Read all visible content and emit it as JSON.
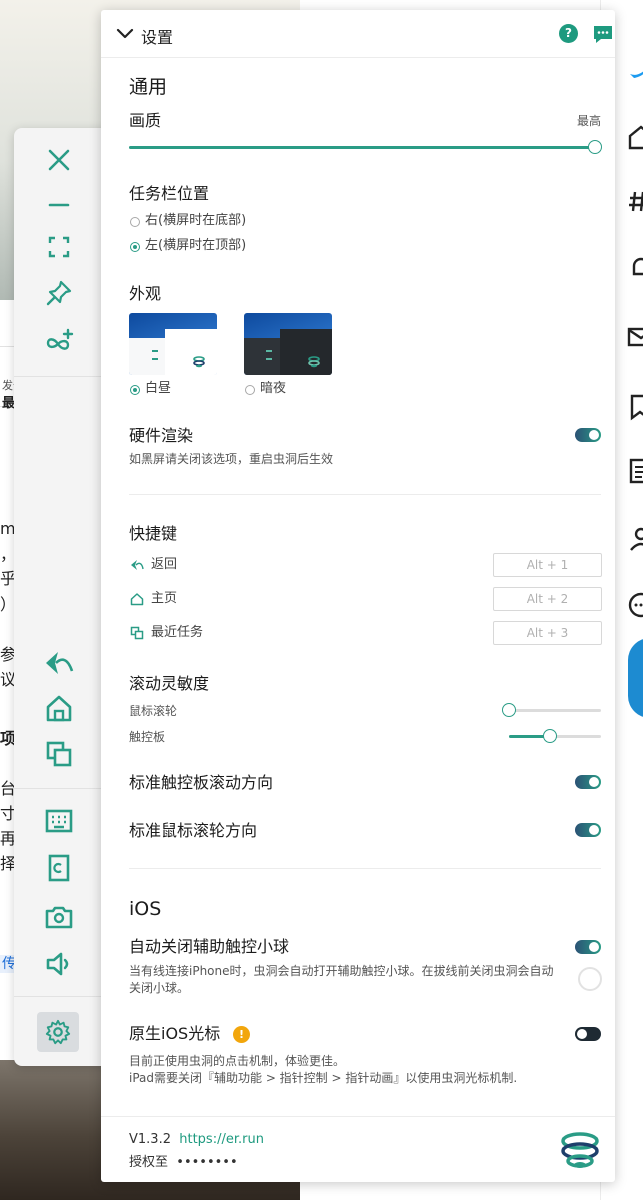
{
  "background": {
    "fragments": [
      "m",
      "，",
      "乎",
      "）",
      "参",
      "议",
      "项",
      "台",
      "寸",
      "再",
      "择"
    ],
    "small_fragment": "发于",
    "bold_fragment": "最的",
    "link_fragment": "传"
  },
  "panel": {
    "title": "设置",
    "help_label": "?",
    "general": {
      "heading": "通用",
      "quality_label": "画质",
      "quality_max_label": "最高",
      "quality_value": 1.0
    },
    "taskbar": {
      "heading": "任务栏位置",
      "options": [
        {
          "label": "右(横屏时在底部)",
          "selected": false
        },
        {
          "label": "左(横屏时在顶部)",
          "selected": true
        }
      ]
    },
    "appearance": {
      "heading": "外观",
      "themes": [
        {
          "label": "白昼",
          "selected": true
        },
        {
          "label": "暗夜",
          "selected": false
        }
      ]
    },
    "hardware": {
      "heading": "硬件渲染",
      "hint": "如黑屏请关闭该选项，重启虫洞后生效",
      "enabled": true
    },
    "shortcuts": {
      "heading": "快捷键",
      "items": [
        {
          "label": "返回",
          "key": "Alt + 1",
          "icon": "back-icon"
        },
        {
          "label": "主页",
          "key": "Alt + 2",
          "icon": "home-icon"
        },
        {
          "label": "最近任务",
          "key": "Alt + 3",
          "icon": "recent-tasks-icon"
        }
      ]
    },
    "scroll": {
      "heading": "滚动灵敏度",
      "mouse_label": "鼠标滚轮",
      "mouse_value": 0.0,
      "touchpad_label": "触控板",
      "touchpad_value": 0.45
    },
    "touchpad_direction": {
      "label": "标准触控板滚动方向",
      "enabled": true
    },
    "mouse_direction": {
      "label": "标准鼠标滚轮方向",
      "enabled": true
    },
    "ios": {
      "heading": "iOS",
      "assistive": {
        "label": "自动关闭辅助触控小球",
        "hint_line1": "当有线连接iPhone时，虫洞会自动打开辅助触控小球。在拔线前关闭虫洞会自动",
        "hint_line2": "关闭小球。",
        "enabled": true
      },
      "native_cursor": {
        "label": "原生iOS光标",
        "warn_label": "!",
        "hint_line1": "目前正使用虫洞的点击机制，体验更佳。",
        "hint_line2": "iPad需要关闭『辅助功能 > 指针控制 > 指针动画』以使用虫洞光标机制.",
        "enabled": false
      }
    },
    "footer": {
      "version": "V1.3.2",
      "url": "https://er.run",
      "license_label": "授权至",
      "license_value": "••••••••"
    }
  },
  "colors": {
    "accent": "#2a9c86",
    "toggle_dark": "#2b5275",
    "warning": "#f2a60c"
  }
}
